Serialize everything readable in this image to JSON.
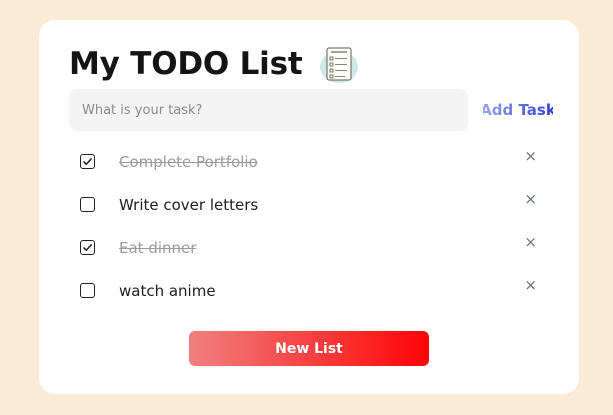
{
  "header": {
    "title": "My TODO List",
    "icon": "notepad-checklist-icon"
  },
  "input": {
    "placeholder": "What is your task?",
    "value": ""
  },
  "add_task": {
    "label": "Add Task"
  },
  "tasks": [
    {
      "text": "Complete Portfolio",
      "done": true
    },
    {
      "text": "Write cover letters",
      "done": false
    },
    {
      "text": "Eat dinner",
      "done": true
    },
    {
      "text": "watch anime",
      "done": false
    }
  ],
  "delete_symbol": "×",
  "new_list": {
    "label": "New List"
  },
  "colors": {
    "background": "#fbead6",
    "card": "#ffffff",
    "add_task_gradient": [
      "#9aa6e6",
      "#2d3fd8"
    ],
    "new_list_gradient": [
      "#f0807f",
      "#ff0404"
    ],
    "done_text": "#9b9b9b"
  }
}
